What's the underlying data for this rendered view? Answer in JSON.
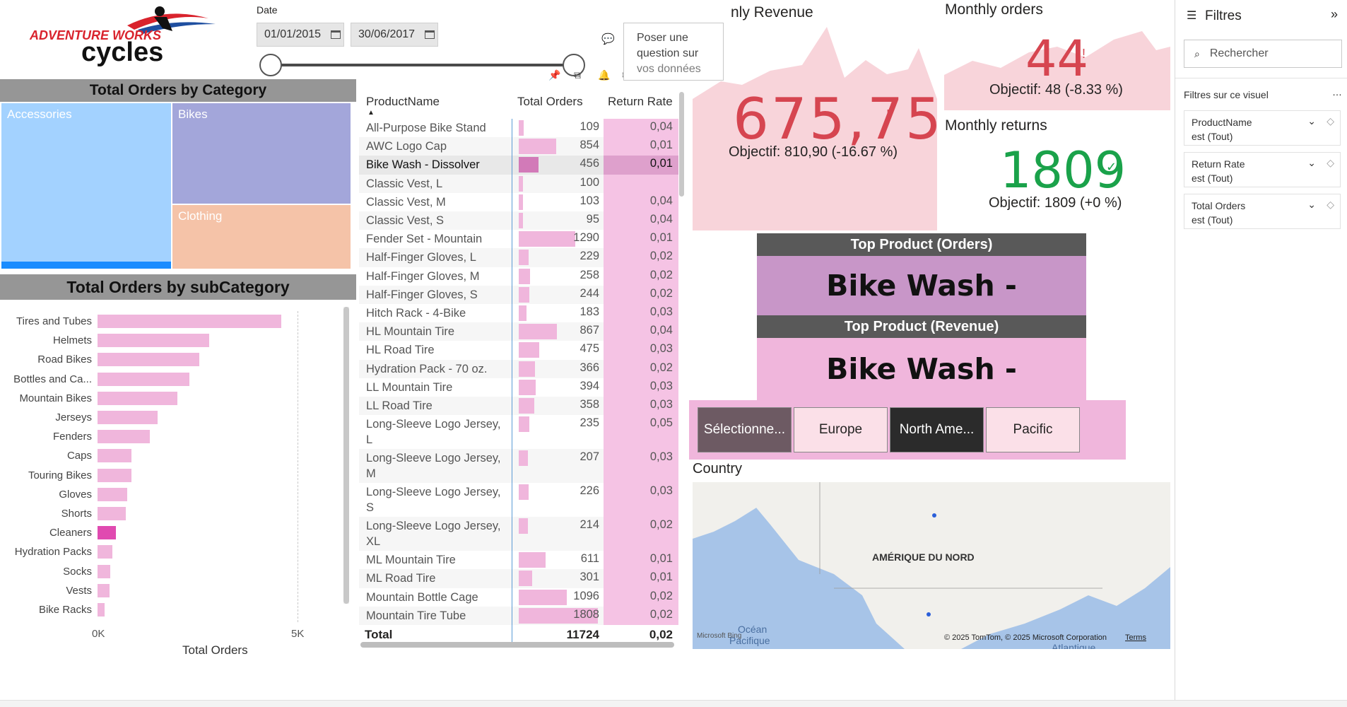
{
  "logo": {
    "line1": "ADVENTURE WORKS",
    "line2": "cycles"
  },
  "date_slicer": {
    "label": "Date",
    "start": "01/01/2015",
    "end": "30/06/2017"
  },
  "qa": {
    "text_lines": [
      "Poser une",
      "question sur",
      "vos données"
    ]
  },
  "treemap": {
    "title": "Total Orders by Category",
    "cells": [
      {
        "label": "Accessories",
        "color": "#a3d2ff"
      },
      {
        "label": "Bikes",
        "color": "#a3a6da"
      },
      {
        "label": "Clothing",
        "color": "#f5c3a8"
      }
    ]
  },
  "subcategory_chart": {
    "title": "Total Orders by subCategory",
    "xlabel": "Total Orders",
    "ticks": [
      "0K",
      "5K"
    ],
    "chart_data": {
      "type": "bar",
      "orientation": "horizontal",
      "categories": [
        "Tires and Tubes",
        "Helmets",
        "Road Bikes",
        "Bottles and Ca...",
        "Mountain Bikes",
        "Jerseys",
        "Fenders",
        "Caps",
        "Touring Bikes",
        "Gloves",
        "Shorts",
        "Cleaners",
        "Hydration Packs",
        "Socks",
        "Vests",
        "Bike Racks"
      ],
      "values": [
        4600,
        2800,
        2550,
        2300,
        2000,
        1500,
        1300,
        850,
        850,
        750,
        700,
        456,
        366,
        320,
        300,
        180
      ],
      "highlight": "Cleaners",
      "xlim": [
        0,
        5000
      ]
    }
  },
  "table": {
    "headers": {
      "name": "ProductName",
      "orders": "Total Orders",
      "rate": "Return Rate"
    },
    "rows": [
      {
        "name": "All-Purpose Bike Stand",
        "orders": "109",
        "rate": "0,04"
      },
      {
        "name": "AWC Logo Cap",
        "orders": "854",
        "rate": "0,01"
      },
      {
        "name": "Bike Wash - Dissolver",
        "orders": "456",
        "rate": "0,01"
      },
      {
        "name": "Classic Vest, L",
        "orders": "100",
        "rate": ""
      },
      {
        "name": "Classic Vest, M",
        "orders": "103",
        "rate": "0,04"
      },
      {
        "name": "Classic Vest, S",
        "orders": "95",
        "rate": "0,04"
      },
      {
        "name": "Fender Set - Mountain",
        "orders": "1290",
        "rate": "0,01"
      },
      {
        "name": "Half-Finger Gloves, L",
        "orders": "229",
        "rate": "0,02"
      },
      {
        "name": "Half-Finger Gloves, M",
        "orders": "258",
        "rate": "0,02"
      },
      {
        "name": "Half-Finger Gloves, S",
        "orders": "244",
        "rate": "0,02"
      },
      {
        "name": "Hitch Rack - 4-Bike",
        "orders": "183",
        "rate": "0,03"
      },
      {
        "name": "HL Mountain Tire",
        "orders": "867",
        "rate": "0,04"
      },
      {
        "name": "HL Road Tire",
        "orders": "475",
        "rate": "0,03"
      },
      {
        "name": "Hydration Pack - 70 oz.",
        "orders": "366",
        "rate": "0,02"
      },
      {
        "name": "LL Mountain Tire",
        "orders": "394",
        "rate": "0,03"
      },
      {
        "name": "LL Road Tire",
        "orders": "358",
        "rate": "0,03"
      },
      {
        "name": "Long-Sleeve Logo Jersey, L",
        "orders": "235",
        "rate": "0,05"
      },
      {
        "name": "Long-Sleeve Logo Jersey, M",
        "orders": "207",
        "rate": "0,03"
      },
      {
        "name": "Long-Sleeve Logo Jersey, S",
        "orders": "226",
        "rate": "0,03"
      },
      {
        "name": "Long-Sleeve Logo Jersey, XL",
        "orders": "214",
        "rate": "0,02"
      },
      {
        "name": "ML Mountain Tire",
        "orders": "611",
        "rate": "0,01"
      },
      {
        "name": "ML Road Tire",
        "orders": "301",
        "rate": "0,01"
      },
      {
        "name": "Mountain Bottle Cage",
        "orders": "1096",
        "rate": "0,02"
      },
      {
        "name": "Mountain Tire Tube",
        "orders": "1808",
        "rate": "0,02"
      }
    ],
    "total": {
      "label": "Total",
      "orders": "11724",
      "rate": "0,02"
    },
    "max_orders": 1808,
    "selected": "Bike Wash - Dissolver"
  },
  "kpi_revenue": {
    "title": "nly Revenue",
    "value": "675,75",
    "mark": "!",
    "goal": "Objectif: 810,90 (-16.67 %)"
  },
  "kpi_orders": {
    "title": "Monthly orders",
    "value": "44",
    "mark": "!",
    "goal": "Objectif: 48 (-8.33 %)"
  },
  "kpi_returns": {
    "title": "Monthly returns",
    "value": "1809",
    "mark": "✓",
    "goal": "Objectif: 1809 (+0 %)"
  },
  "top_orders": {
    "title": "Top Product (Orders)",
    "value": "Bike Wash - Dissolver"
  },
  "top_revenue": {
    "title": "Top Product (Revenue)",
    "value": "Bike Wash - Dissolver"
  },
  "regions": [
    {
      "label": "Sélectionne...",
      "bg": "#6d5a63",
      "fg": "#ffffff"
    },
    {
      "label": "Europe",
      "bg": "#fbe0e8",
      "fg": "#252423"
    },
    {
      "label": "North Ame...",
      "bg": "#2b2b2b",
      "fg": "#ffffff"
    },
    {
      "label": "Pacific",
      "bg": "#fbe0e8",
      "fg": "#252423"
    }
  ],
  "map": {
    "title": "Country",
    "region_label": "AMÉRIQUE DU NORD",
    "ocean1": "Océan",
    "ocean2": "Pacifique",
    "ocean3": "Atlantique",
    "copyright": "© 2025 TomTom, © 2025 Microsoft Corporation",
    "terms": "Terms",
    "bing": "Microsoft Bing"
  },
  "filters": {
    "title": "Filtres",
    "search_placeholder": "Rechercher",
    "section": "Filtres sur ce visuel",
    "cards": [
      {
        "name": "ProductName",
        "state": "est (Tout)"
      },
      {
        "name": "Return Rate",
        "state": "est (Tout)"
      },
      {
        "name": "Total Orders",
        "state": "est (Tout)"
      }
    ]
  }
}
